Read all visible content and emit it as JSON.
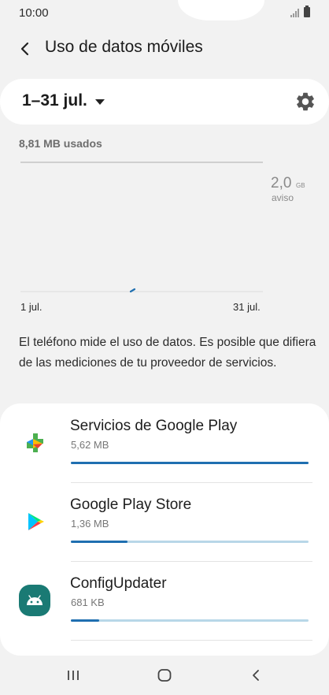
{
  "status": {
    "time": "10:00"
  },
  "header": {
    "title": "Uso de datos móviles"
  },
  "period": {
    "label": "1–31 jul."
  },
  "usage": {
    "used_label": "8,81 MB usados",
    "warning_value": "2,0",
    "warning_unit": "GB",
    "warning_label": "aviso",
    "x_start": "1 jul.",
    "x_end": "31 jul."
  },
  "info_text": "El teléfono mide el uso de datos. Es posible que difiera de las mediciones de tu proveedor de servicios.",
  "apps": [
    {
      "name": "Servicios de Google Play",
      "size": "5,62 MB",
      "fraction": 1.0,
      "icon": "google-play-services-icon"
    },
    {
      "name": "Google Play Store",
      "size": "1,36 MB",
      "fraction": 0.24,
      "icon": "google-play-store-icon"
    },
    {
      "name": "ConfigUpdater",
      "size": "681 KB",
      "fraction": 0.12,
      "icon": "android-icon"
    }
  ],
  "colors": {
    "accent": "#1f6fb0",
    "bar_track": "#b8d7e8",
    "android_icon_bg": "#1a7a74"
  }
}
